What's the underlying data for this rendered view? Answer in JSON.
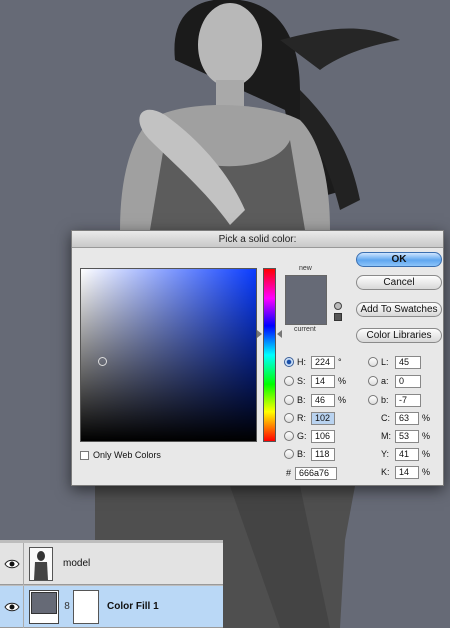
{
  "dialog": {
    "title": "Pick a solid color:",
    "new_label": "new",
    "current_label": "current",
    "buttons": {
      "ok": "OK",
      "cancel": "Cancel",
      "add_to_swatches": "Add To Swatches",
      "color_libraries": "Color Libraries"
    },
    "only_web_colors": "Only Web Colors",
    "hsb": {
      "h": {
        "label": "H:",
        "value": "224",
        "unit": "°"
      },
      "s": {
        "label": "S:",
        "value": "14",
        "unit": "%"
      },
      "b": {
        "label": "B:",
        "value": "46",
        "unit": "%"
      }
    },
    "rgb": {
      "r": {
        "label": "R:",
        "value": "102"
      },
      "g": {
        "label": "G:",
        "value": "106"
      },
      "b": {
        "label": "B:",
        "value": "118"
      }
    },
    "lab": {
      "l": {
        "label": "L:",
        "value": "45"
      },
      "a": {
        "label": "a:",
        "value": "0"
      },
      "b": {
        "label": "b:",
        "value": "-7"
      }
    },
    "cmyk": {
      "c": {
        "label": "C:",
        "value": "63",
        "unit": "%"
      },
      "m": {
        "label": "M:",
        "value": "53",
        "unit": "%"
      },
      "y": {
        "label": "Y:",
        "value": "41",
        "unit": "%"
      },
      "k": {
        "label": "K:",
        "value": "14",
        "unit": "%"
      }
    },
    "hex": {
      "label": "#",
      "value": "666a76"
    }
  },
  "layers": {
    "model": {
      "name": "model"
    },
    "fill": {
      "name": "Color Fill 1",
      "chain": "8"
    }
  },
  "colors": {
    "fill_color": "#666a76",
    "accent": "#5fa6ef",
    "selected_layer": "#bad8f6"
  }
}
